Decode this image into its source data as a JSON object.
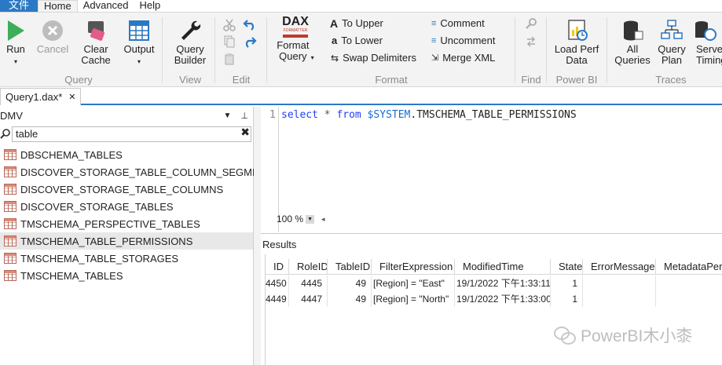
{
  "menu": {
    "file": "文件",
    "tabs": [
      "Home",
      "Advanced",
      "Help"
    ]
  },
  "ribbon": {
    "query": {
      "run": "Run",
      "cancel": "Cancel",
      "clear_cache": "Clear\nCache",
      "output": "Output",
      "group": "Query"
    },
    "view": {
      "query_builder": "Query\nBuilder",
      "group": "View"
    },
    "edit": {
      "group": "Edit"
    },
    "format": {
      "format_query": "Format\nQuery",
      "dax_logo": "DAX",
      "dax_sub": "FORMATTER",
      "to_upper": "To Upper",
      "to_lower": "To Lower",
      "swap_delimiters": "Swap Delimiters",
      "comment": "Comment",
      "uncomment": "Uncomment",
      "merge_xml": "Merge XML",
      "group": "Format"
    },
    "find": {
      "group": "Find"
    },
    "powerbi": {
      "load_perf_data": "Load Perf\nData",
      "group": "Power BI"
    },
    "traces": {
      "all_queries": "All\nQueries",
      "query_plan": "Query\nPlan",
      "server_timings": "Server\nTimings",
      "group": "Traces"
    }
  },
  "doc_tab": {
    "label": "Query1.dax*",
    "close": "✕"
  },
  "dmv": {
    "title": "DMV",
    "search_value": "table",
    "items": [
      "DBSCHEMA_TABLES",
      "DISCOVER_STORAGE_TABLE_COLUMN_SEGMENTS",
      "DISCOVER_STORAGE_TABLE_COLUMNS",
      "DISCOVER_STORAGE_TABLES",
      "TMSCHEMA_PERSPECTIVE_TABLES",
      "TMSCHEMA_TABLE_PERMISSIONS",
      "TMSCHEMA_TABLE_STORAGES",
      "TMSCHEMA_TABLES"
    ],
    "selected_index": 5
  },
  "editor": {
    "line_number": "1",
    "kw_select": "select",
    "star": " * ",
    "kw_from": "from",
    "var": " $SYSTEM",
    "rest": ".TMSCHEMA_TABLE_PERMISSIONS",
    "zoom": "100 %"
  },
  "results": {
    "label": "Results",
    "columns": [
      "ID",
      "RoleID",
      "TableID",
      "FilterExpression",
      "ModifiedTime",
      "State",
      "ErrorMessage",
      "MetadataPermission"
    ],
    "rows": [
      [
        "4450",
        "4445",
        "49",
        "[Region] = \"East\"",
        "19/1/2022 下午1:33:11",
        "1",
        "",
        ""
      ],
      [
        "4449",
        "4447",
        "49",
        "[Region] = \"North\"",
        "19/1/2022 下午1:33:00",
        "1",
        "",
        ""
      ]
    ]
  },
  "watermark": "PowerBI木小桼"
}
